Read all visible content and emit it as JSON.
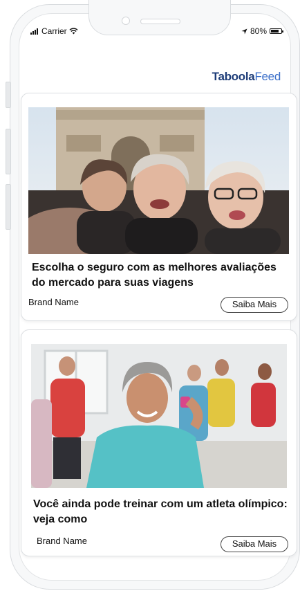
{
  "status_bar": {
    "carrier": "Carrier",
    "battery": "80%",
    "battery_level": 0.8
  },
  "logo": {
    "brand": "Taboola",
    "suffix": "Feed"
  },
  "feed": [
    {
      "title": "Escolha o seguro com as melhores avaliações do mercado para suas viagens",
      "brand": "Brand Name",
      "cta": "Saiba Mais",
      "image": "selfie-senior-women-arc-de-triomphe"
    },
    {
      "title": "Você ainda pode treinar com um atleta olímpico: veja como",
      "brand": "Brand Name",
      "cta": "Saiba Mais",
      "image": "senior-woman-dumbbell-workout-class"
    }
  ]
}
